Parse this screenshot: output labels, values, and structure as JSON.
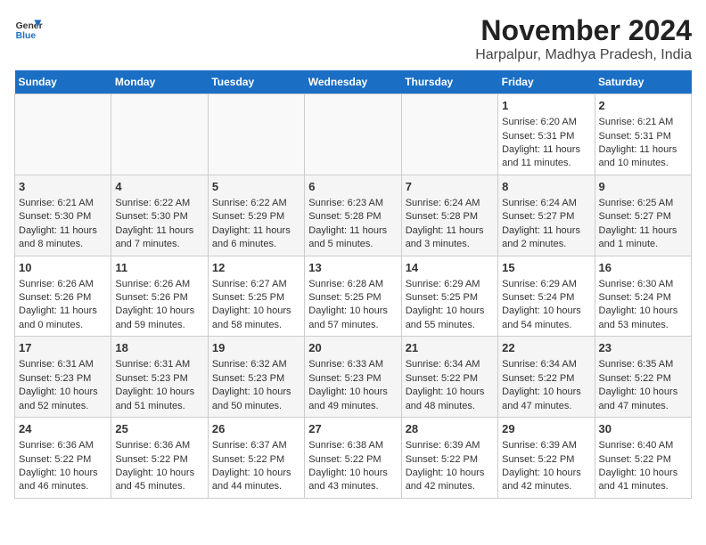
{
  "header": {
    "logo_line1": "General",
    "logo_line2": "Blue",
    "month_year": "November 2024",
    "location": "Harpalpur, Madhya Pradesh, India"
  },
  "weekdays": [
    "Sunday",
    "Monday",
    "Tuesday",
    "Wednesday",
    "Thursday",
    "Friday",
    "Saturday"
  ],
  "weeks": [
    [
      {
        "day": "",
        "info": ""
      },
      {
        "day": "",
        "info": ""
      },
      {
        "day": "",
        "info": ""
      },
      {
        "day": "",
        "info": ""
      },
      {
        "day": "",
        "info": ""
      },
      {
        "day": "1",
        "info": "Sunrise: 6:20 AM\nSunset: 5:31 PM\nDaylight: 11 hours and 11 minutes."
      },
      {
        "day": "2",
        "info": "Sunrise: 6:21 AM\nSunset: 5:31 PM\nDaylight: 11 hours and 10 minutes."
      }
    ],
    [
      {
        "day": "3",
        "info": "Sunrise: 6:21 AM\nSunset: 5:30 PM\nDaylight: 11 hours and 8 minutes."
      },
      {
        "day": "4",
        "info": "Sunrise: 6:22 AM\nSunset: 5:30 PM\nDaylight: 11 hours and 7 minutes."
      },
      {
        "day": "5",
        "info": "Sunrise: 6:22 AM\nSunset: 5:29 PM\nDaylight: 11 hours and 6 minutes."
      },
      {
        "day": "6",
        "info": "Sunrise: 6:23 AM\nSunset: 5:28 PM\nDaylight: 11 hours and 5 minutes."
      },
      {
        "day": "7",
        "info": "Sunrise: 6:24 AM\nSunset: 5:28 PM\nDaylight: 11 hours and 3 minutes."
      },
      {
        "day": "8",
        "info": "Sunrise: 6:24 AM\nSunset: 5:27 PM\nDaylight: 11 hours and 2 minutes."
      },
      {
        "day": "9",
        "info": "Sunrise: 6:25 AM\nSunset: 5:27 PM\nDaylight: 11 hours and 1 minute."
      }
    ],
    [
      {
        "day": "10",
        "info": "Sunrise: 6:26 AM\nSunset: 5:26 PM\nDaylight: 11 hours and 0 minutes."
      },
      {
        "day": "11",
        "info": "Sunrise: 6:26 AM\nSunset: 5:26 PM\nDaylight: 10 hours and 59 minutes."
      },
      {
        "day": "12",
        "info": "Sunrise: 6:27 AM\nSunset: 5:25 PM\nDaylight: 10 hours and 58 minutes."
      },
      {
        "day": "13",
        "info": "Sunrise: 6:28 AM\nSunset: 5:25 PM\nDaylight: 10 hours and 57 minutes."
      },
      {
        "day": "14",
        "info": "Sunrise: 6:29 AM\nSunset: 5:25 PM\nDaylight: 10 hours and 55 minutes."
      },
      {
        "day": "15",
        "info": "Sunrise: 6:29 AM\nSunset: 5:24 PM\nDaylight: 10 hours and 54 minutes."
      },
      {
        "day": "16",
        "info": "Sunrise: 6:30 AM\nSunset: 5:24 PM\nDaylight: 10 hours and 53 minutes."
      }
    ],
    [
      {
        "day": "17",
        "info": "Sunrise: 6:31 AM\nSunset: 5:23 PM\nDaylight: 10 hours and 52 minutes."
      },
      {
        "day": "18",
        "info": "Sunrise: 6:31 AM\nSunset: 5:23 PM\nDaylight: 10 hours and 51 minutes."
      },
      {
        "day": "19",
        "info": "Sunrise: 6:32 AM\nSunset: 5:23 PM\nDaylight: 10 hours and 50 minutes."
      },
      {
        "day": "20",
        "info": "Sunrise: 6:33 AM\nSunset: 5:23 PM\nDaylight: 10 hours and 49 minutes."
      },
      {
        "day": "21",
        "info": "Sunrise: 6:34 AM\nSunset: 5:22 PM\nDaylight: 10 hours and 48 minutes."
      },
      {
        "day": "22",
        "info": "Sunrise: 6:34 AM\nSunset: 5:22 PM\nDaylight: 10 hours and 47 minutes."
      },
      {
        "day": "23",
        "info": "Sunrise: 6:35 AM\nSunset: 5:22 PM\nDaylight: 10 hours and 47 minutes."
      }
    ],
    [
      {
        "day": "24",
        "info": "Sunrise: 6:36 AM\nSunset: 5:22 PM\nDaylight: 10 hours and 46 minutes."
      },
      {
        "day": "25",
        "info": "Sunrise: 6:36 AM\nSunset: 5:22 PM\nDaylight: 10 hours and 45 minutes."
      },
      {
        "day": "26",
        "info": "Sunrise: 6:37 AM\nSunset: 5:22 PM\nDaylight: 10 hours and 44 minutes."
      },
      {
        "day": "27",
        "info": "Sunrise: 6:38 AM\nSunset: 5:22 PM\nDaylight: 10 hours and 43 minutes."
      },
      {
        "day": "28",
        "info": "Sunrise: 6:39 AM\nSunset: 5:22 PM\nDaylight: 10 hours and 42 minutes."
      },
      {
        "day": "29",
        "info": "Sunrise: 6:39 AM\nSunset: 5:22 PM\nDaylight: 10 hours and 42 minutes."
      },
      {
        "day": "30",
        "info": "Sunrise: 6:40 AM\nSunset: 5:22 PM\nDaylight: 10 hours and 41 minutes."
      }
    ]
  ]
}
